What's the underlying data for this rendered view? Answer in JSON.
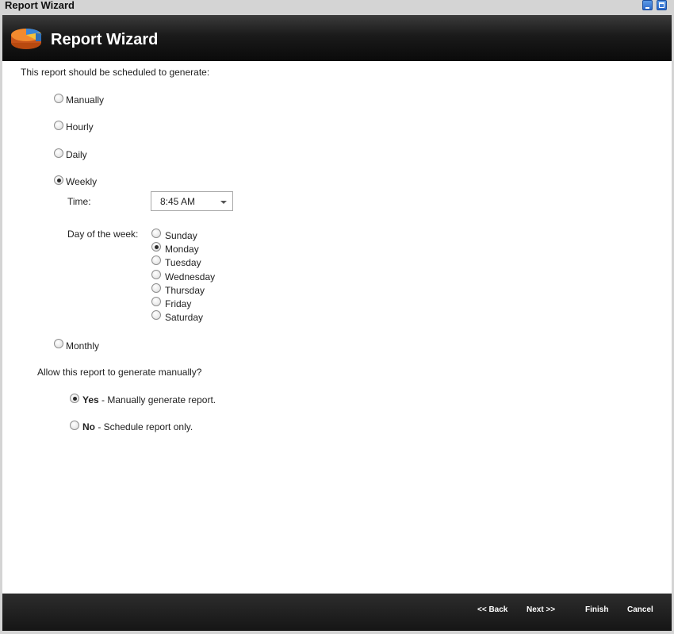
{
  "window": {
    "title": "Report Wizard"
  },
  "header": {
    "title": "Report Wizard"
  },
  "schedule": {
    "prompt": "This report should be scheduled to generate:",
    "options": {
      "manually": "Manually",
      "hourly": "Hourly",
      "daily": "Daily",
      "weekly": "Weekly",
      "monthly": "Monthly"
    },
    "selected": "Weekly",
    "time_label": "Time:",
    "time_value": "8:45 AM",
    "day_label": "Day of the week:",
    "days": [
      "Sunday",
      "Monday",
      "Tuesday",
      "Wednesday",
      "Thursday",
      "Friday",
      "Saturday"
    ],
    "selected_day": "Monday"
  },
  "manual": {
    "prompt": "Allow this report to generate manually?",
    "yes_label": "Yes",
    "yes_desc": " - Manually generate report.",
    "no_label": "No",
    "no_desc": " - Schedule report only.",
    "selected": "Yes"
  },
  "footer": {
    "back": "<< Back",
    "next": "Next >>",
    "finish": "Finish",
    "cancel": "Cancel"
  }
}
